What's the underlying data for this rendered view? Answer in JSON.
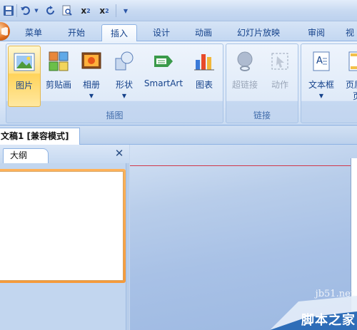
{
  "quick_access": {
    "icons": [
      "save-icon",
      "undo-icon",
      "undo-dropdown-icon",
      "redo-icon",
      "print-preview-icon",
      "superscript-icon",
      "subscript-icon",
      "customize-dropdown-icon"
    ],
    "superscript": "x",
    "subscript": "x"
  },
  "tabs": [
    {
      "label": "菜单"
    },
    {
      "label": "开始"
    },
    {
      "label": "插入",
      "active": true
    },
    {
      "label": "设计"
    },
    {
      "label": "动画"
    },
    {
      "label": "幻灯片放映"
    },
    {
      "label": "审阅"
    },
    {
      "label": "视"
    }
  ],
  "ribbon": {
    "groups": [
      {
        "label": "插图",
        "buttons": [
          "图片",
          "剪贴画",
          "相册",
          "形状",
          "SmartArt",
          "图表"
        ]
      },
      {
        "label": "链接",
        "buttons": [
          "超链接",
          "动作"
        ]
      },
      {
        "label": "",
        "buttons": [
          "文本框",
          "页眉"
        ]
      }
    ],
    "picture": "图片",
    "clipart": "剪贴画",
    "album": "相册",
    "shapes": "形状",
    "smartart": "SmartArt",
    "chart": "图表",
    "hyperlink": "超链接",
    "action": "动作",
    "textbox": "文本框",
    "header": "页眉",
    "header2": "页",
    "group_illustrations": "插图",
    "group_links": "链接"
  },
  "document": {
    "tab_title": "文稿1 [兼容模式]"
  },
  "left_pane": {
    "tab_label": "大纲",
    "close_symbol": "✕"
  },
  "watermark": {
    "site": "jb51.net",
    "name": "脚本之家"
  },
  "colors": {
    "accent_orange": "#f59a3a",
    "ribbon_text": "#15428b",
    "ruler_red": "#d0384a"
  }
}
